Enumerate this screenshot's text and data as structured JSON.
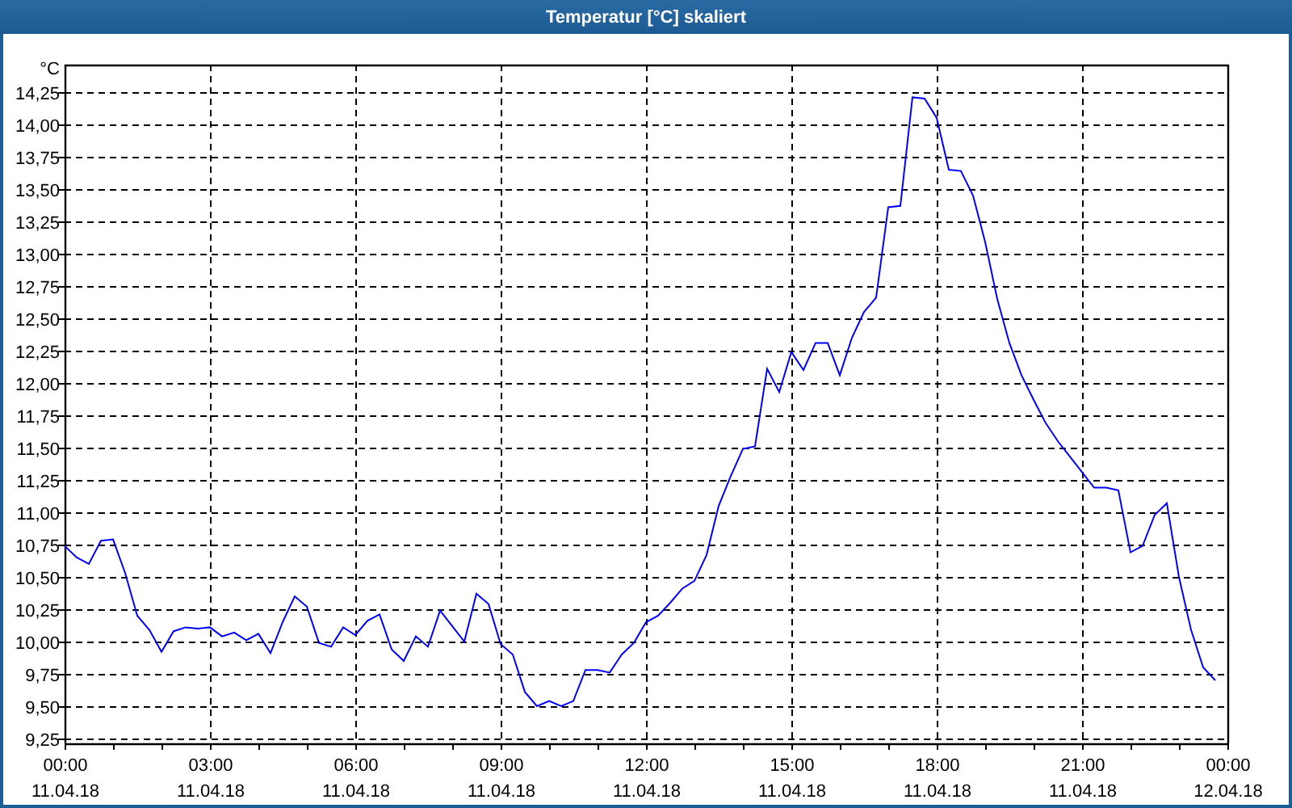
{
  "window": {
    "title": "Temperatur [°C] skaliert"
  },
  "chart": {
    "chart_data": {
      "type": "line",
      "ylabel": "°C",
      "categories": [
        "00:00\n11.04.18",
        null,
        null,
        null,
        null,
        null,
        null,
        null,
        null,
        null,
        null,
        null,
        "03:00\n11.04.18",
        null,
        null,
        null,
        null,
        null,
        null,
        null,
        null,
        null,
        null,
        null,
        "06:00\n11.04.18",
        null,
        null,
        null,
        null,
        null,
        null,
        null,
        null,
        null,
        null,
        null,
        "09:00\n11.04.18",
        null,
        null,
        null,
        null,
        null,
        null,
        null,
        null,
        null,
        null,
        null,
        "12:00\n11.04.18",
        null,
        null,
        null,
        null,
        null,
        null,
        null,
        null,
        null,
        null,
        null,
        "15:00\n11.04.18",
        null,
        null,
        null,
        null,
        null,
        null,
        null,
        null,
        null,
        null,
        null,
        "18:00\n11.04.18",
        null,
        null,
        null,
        null,
        null,
        null,
        null,
        null,
        null,
        null,
        null,
        "21:00\n11.04.18",
        null,
        null,
        null,
        null,
        null,
        null,
        null,
        null,
        null,
        null,
        null,
        "00:00\n12.04.18"
      ],
      "series": [
        {
          "color": "#0000ff",
          "values": [
            10.74,
            10.65,
            10.6,
            10.78,
            10.79,
            10.53,
            10.2,
            10.09,
            9.92,
            10.08,
            10.11,
            10.1,
            10.11,
            10.04,
            10.07,
            10.01,
            10.06,
            9.91,
            10.15,
            10.35,
            10.27,
            9.99,
            9.96,
            10.11,
            10.05,
            10.16,
            10.21,
            9.94,
            9.85,
            10.04,
            9.96,
            10.24,
            10.12,
            10.0,
            10.37,
            10.29,
            9.98,
            9.9,
            9.61,
            9.5,
            9.54,
            9.5,
            9.54,
            9.78,
            9.78,
            9.76,
            9.9,
            9.99,
            10.15,
            10.2,
            10.3,
            10.41,
            10.47,
            10.67,
            11.05,
            11.28,
            11.49,
            11.51,
            12.11,
            11.93,
            12.24,
            12.1,
            12.31,
            12.31,
            12.06,
            12.35,
            12.55,
            12.66,
            13.36,
            13.37,
            14.21,
            14.2,
            14.05,
            13.65,
            13.64,
            13.45,
            13.09,
            12.65,
            12.31,
            12.06,
            11.87,
            11.69,
            11.55,
            11.43,
            11.31,
            11.19,
            11.19,
            11.17,
            10.69,
            10.74,
            10.98,
            11.07,
            10.5,
            10.09,
            9.8,
            9.7,
            null
          ]
        }
      ],
      "grid": true,
      "ylim": [
        9.2125,
        14.4625
      ],
      "yticks": [
        {
          "value": 9.25,
          "label": "9,25"
        },
        {
          "value": 9.5,
          "label": "9,50"
        },
        {
          "value": 9.75,
          "label": "9,75"
        },
        {
          "value": 10,
          "label": "10,00"
        },
        {
          "value": 10.25,
          "label": "10,25"
        },
        {
          "value": 10.5,
          "label": "10,50"
        },
        {
          "value": 10.75,
          "label": "10,75"
        },
        {
          "value": 11,
          "label": "11,00"
        },
        {
          "value": 11.25,
          "label": "11,25"
        },
        {
          "value": 11.5,
          "label": "11,50"
        },
        {
          "value": 11.75,
          "label": "11,75"
        },
        {
          "value": 12,
          "label": "12,00"
        },
        {
          "value": 12.25,
          "label": "12,25"
        },
        {
          "value": 12.5,
          "label": "12,50"
        },
        {
          "value": 12.75,
          "label": "12,75"
        },
        {
          "value": 13,
          "label": "13,00"
        },
        {
          "value": 13.25,
          "label": "13,25"
        },
        {
          "value": 13.5,
          "label": "13,50"
        },
        {
          "value": 13.75,
          "label": "13,75"
        },
        {
          "value": 14,
          "label": "14,00"
        },
        {
          "value": 14.25,
          "label": "14,25"
        }
      ]
    }
  }
}
